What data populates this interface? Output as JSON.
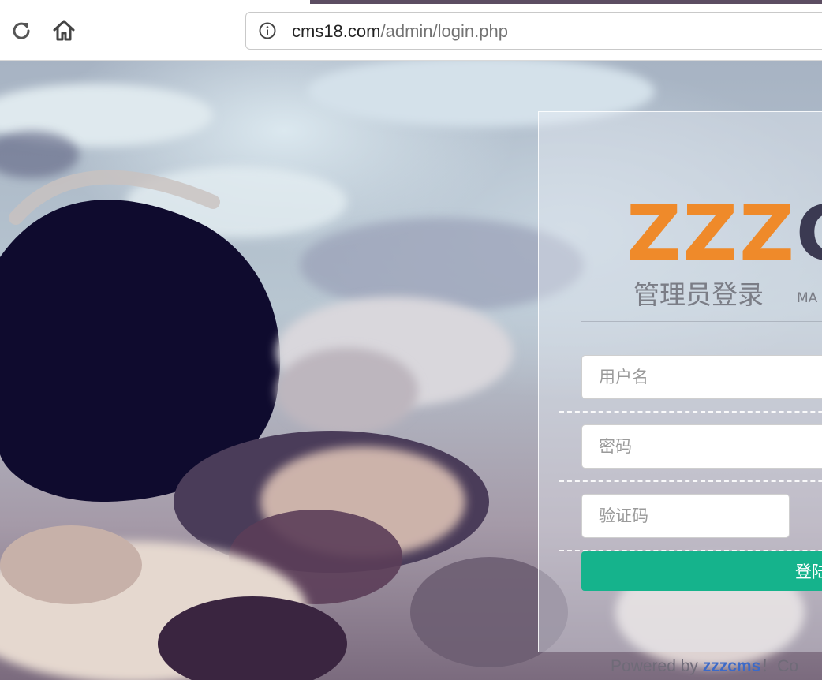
{
  "browser": {
    "url_host": "cms18.com",
    "url_path": "/admin/login.php",
    "reload_icon": "reload-icon",
    "home_icon": "home-icon",
    "info_icon": "info-icon"
  },
  "login": {
    "logo_primary": "ZZZ",
    "logo_secondary": "C",
    "heading": "管理员登录",
    "heading_en": "MA",
    "username_placeholder": "用户名",
    "password_placeholder": "密码",
    "captcha_placeholder": "验证码",
    "submit_label": "登陆"
  },
  "footer": {
    "prefix": "Powered by ",
    "link_text": "zzzcms",
    "suffix": "！Co"
  },
  "colors": {
    "logo_orange": "#ef8a2a",
    "logo_dark": "#3b3a52",
    "button_green": "#15b38c",
    "tab_strip": "#5c4d62"
  }
}
